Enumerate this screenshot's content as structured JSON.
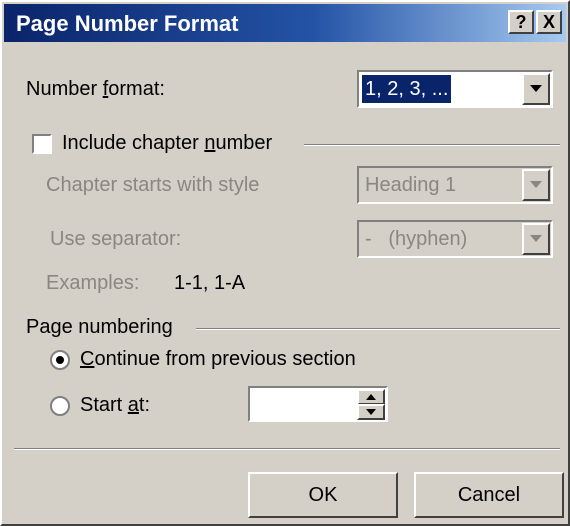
{
  "dialog": {
    "title": "Page Number Format",
    "help_label": "?",
    "close_label": "X"
  },
  "number_format": {
    "label_pre": "Number ",
    "label_accel": "f",
    "label_post": "ormat:",
    "value": "1, 2, 3, ..."
  },
  "chapter": {
    "include_pre": "Include chapter ",
    "include_accel": "n",
    "include_post": "umber",
    "include_checked": false,
    "starts_label": "Chapter starts with style",
    "style_value": "Heading 1",
    "separator_label": "Use separator:",
    "separator_value": "-   (hyphen)",
    "examples_label": "Examples:",
    "examples_value": "1-1, 1-A"
  },
  "page_numbering": {
    "group_label": "Page numbering",
    "continue_accel": "C",
    "continue_post": "ontinue from previous section",
    "continue_selected": true,
    "start_pre": "Start ",
    "start_accel": "a",
    "start_post": "t:",
    "start_value": ""
  },
  "buttons": {
    "ok": "OK",
    "cancel": "Cancel"
  },
  "colors": {
    "title_gradient_start": "#0a246a",
    "title_gradient_end": "#a6caf0",
    "face": "#d4d0c8",
    "disabled_text": "#8a8680",
    "selection": "#0a246a"
  }
}
